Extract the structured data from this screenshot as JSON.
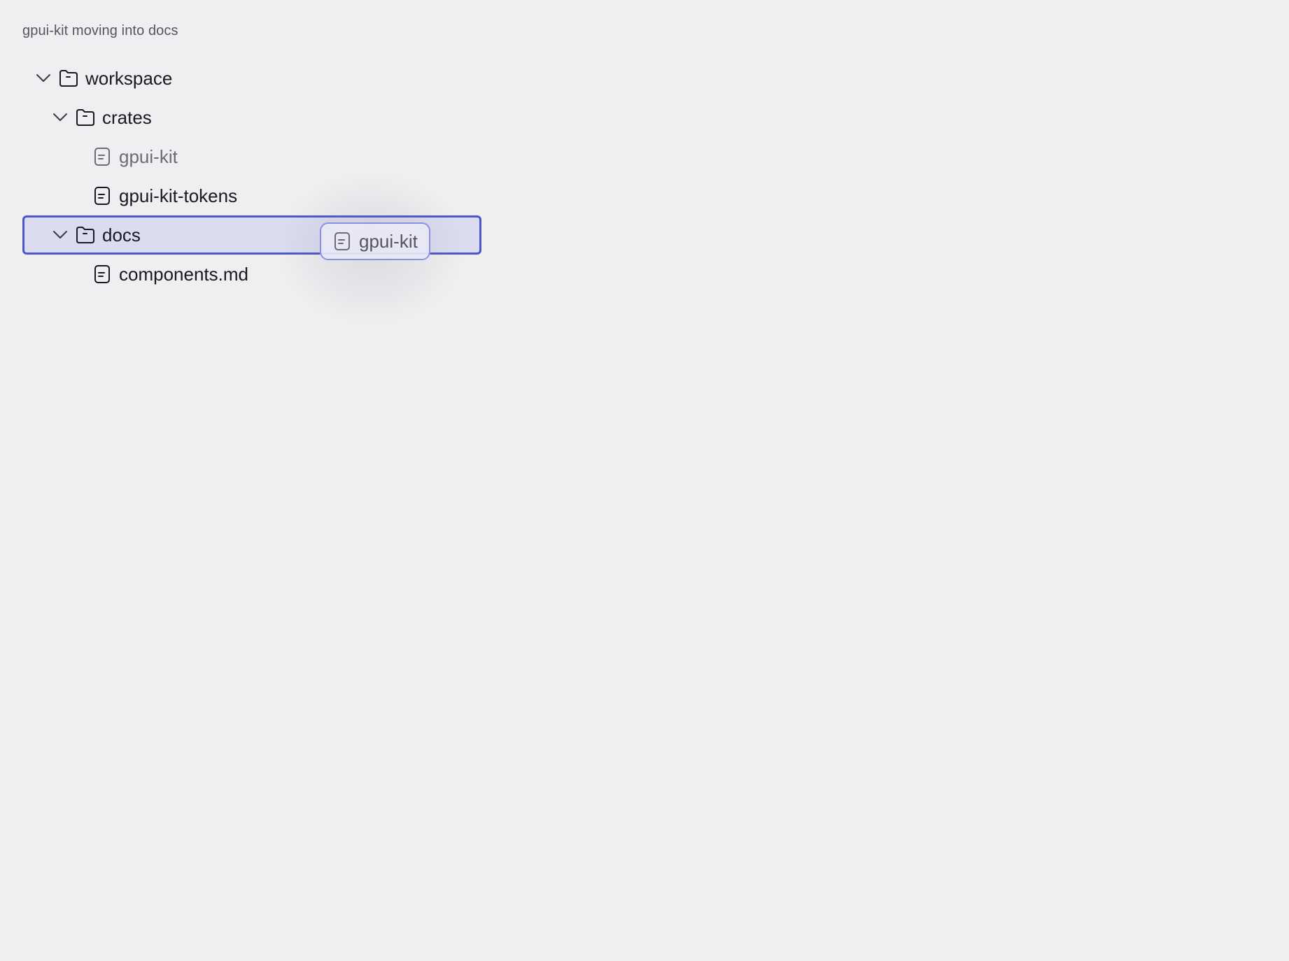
{
  "caption": "gpui-kit moving into docs",
  "tree": {
    "workspace": {
      "label": "workspace",
      "icon": "folder-icon",
      "expanded": true
    },
    "crates": {
      "label": "crates",
      "icon": "folder-icon",
      "expanded": true
    },
    "gpui_kit": {
      "label": "gpui-kit",
      "icon": "file-icon",
      "state": "dragging-source"
    },
    "gpui_kit_tokens": {
      "label": "gpui-kit-tokens",
      "icon": "file-icon"
    },
    "docs": {
      "label": "docs",
      "icon": "folder-icon",
      "expanded": true,
      "state": "drop-target"
    },
    "components_md": {
      "label": "components.md",
      "icon": "file-icon"
    }
  },
  "drag_ghost": {
    "label": "gpui-kit",
    "icon": "file-icon"
  },
  "colors": {
    "background": "#efeff1",
    "drop_target_fill": "#dcdcef",
    "drop_target_border": "#4e57c9",
    "ghost_border": "#8d92dd",
    "dim_text": "#6b6c73"
  }
}
